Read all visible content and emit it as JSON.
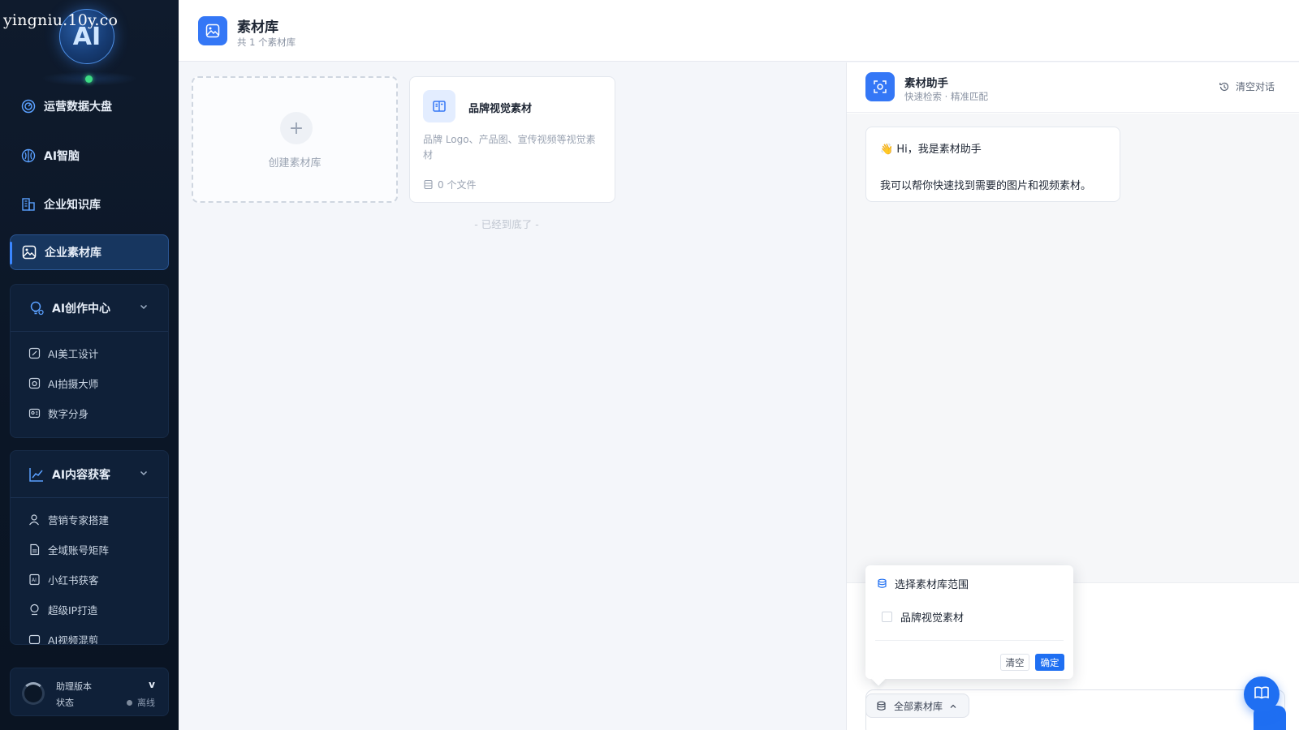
{
  "watermark": "yingniu.10y.co",
  "logo": {
    "text": "AI"
  },
  "sidebar": {
    "nav": [
      {
        "label": "运营数据大盘",
        "icon": "dashboard-icon"
      },
      {
        "label": "AI智脑",
        "icon": "brain-icon"
      },
      {
        "label": "企业知识库",
        "icon": "building-icon"
      },
      {
        "label": "企业素材库",
        "icon": "image-icon",
        "active": true
      }
    ],
    "groups": [
      {
        "label": "AI创作中心",
        "icon": "bulb-icon",
        "items": [
          {
            "label": "AI美工设计",
            "icon": "design-icon"
          },
          {
            "label": "AI拍摄大师",
            "icon": "camera-icon"
          },
          {
            "label": "数字分身",
            "icon": "avatar-icon"
          }
        ]
      },
      {
        "label": "AI内容获客",
        "icon": "chart-icon",
        "items": [
          {
            "label": "营销专家搭建",
            "icon": "user-icon"
          },
          {
            "label": "全域账号矩阵",
            "icon": "doc-icon"
          },
          {
            "label": "小红书获客",
            "icon": "ai-doc-icon"
          },
          {
            "label": "超级IP打造",
            "icon": "medal-icon"
          },
          {
            "label": "AI视频混剪",
            "icon": "video-icon"
          }
        ]
      }
    ],
    "footer": {
      "version_label": "助理版本",
      "version_value": "v",
      "status_label": "状态",
      "status_value": "离线"
    }
  },
  "header": {
    "title": "素材库",
    "subtitle": "共 1 个素材库"
  },
  "main": {
    "create_label": "创建素材库",
    "libraries": [
      {
        "title": "品牌视觉素材",
        "desc": "品牌 Logo、产品图、宣传视频等视觉素材",
        "files": "0 个文件"
      }
    ],
    "end_text": "- 已经到底了 -"
  },
  "assistant": {
    "title": "素材助手",
    "subtitle": "快速检索 · 精准匹配",
    "clear_label": "清空对话",
    "greeting_emoji": "👋",
    "greeting": "Hi，我是素材助手",
    "intro": "我可以帮你快速找到需要的图片和视频素材。",
    "scope_button": "全部素材库"
  },
  "popover": {
    "title": "选择素材库范围",
    "options": [
      "品牌视觉素材"
    ],
    "clear": "清空",
    "ok": "确定"
  },
  "colors": {
    "accent": "#1f6ff2",
    "sidebar_bg": "#0f1b2d",
    "status_online": "#3ddc84"
  }
}
